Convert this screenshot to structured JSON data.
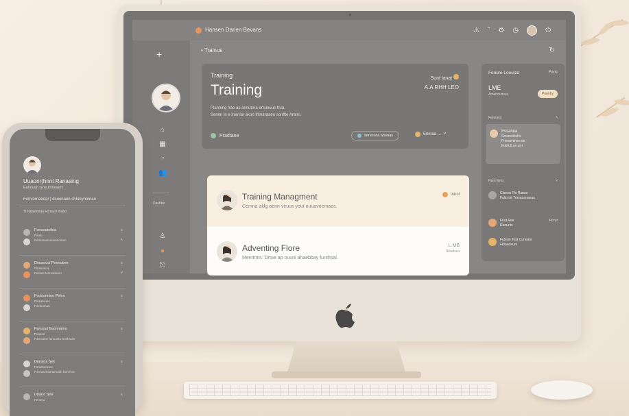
{
  "colors": {
    "accent_orange": "#e8935e",
    "accent_gold": "#e5b46a",
    "card_cream": "#f8efe1",
    "screen_gray": "#8a8886"
  },
  "desktop": {
    "topbar": {
      "title": "Hansen Darien Bevans",
      "icons": [
        "alert-icon",
        "chevron-up-icon",
        "settings-icon",
        "clock-icon",
        "avatar",
        "power-icon"
      ]
    },
    "sidebar": {
      "small_label": "Dashbo"
    },
    "breadcrumb": "Trainus",
    "hero": {
      "kicker": "Training",
      "title": "Training",
      "desc1": "Planning frae as annutora emunuus trua.",
      "desc2": "Senen in e lrorniar akon frlmaraaen sonflte Arann.",
      "top_right1": "Sunt lanat",
      "top_right2": "A.A RHH LEO",
      "footer_left": "Pradtane",
      "pill": "servouns ahanas",
      "footer_right": "Enmaa ..."
    },
    "cards": [
      {
        "title": "Training Managment",
        "subtitle": "Cemna aklg aenn veuus yout ouuavoemaas.",
        "badge": "Innol"
      },
      {
        "title": "Adventing Flore",
        "subtitle": "Menmms. Drtue ap ouuni ahaebbay funthsal.",
        "right1": "L.MB",
        "right2": "Siliudsca"
      }
    ],
    "right_panel": {
      "header": "Feriure Looujza",
      "header_right": "Foris",
      "value": "LME",
      "value_sub": "Amanoumsa",
      "button": "Ponnhy",
      "label1": "Faruiaes",
      "card_title": "Essanea",
      "card_lines": [
        "Secaredrahs",
        "Frimseninen ae",
        "Edefull ue urn"
      ],
      "label2": "Rum Eetu",
      "rows": [
        {
          "t1": "Clanon Ffo Ranoe",
          "t2": "Fulio de Trirsnunnaeas"
        },
        {
          "t1": "Fuut Ree",
          "t2": "Ranunts",
          "r": "Ru ur"
        },
        {
          "t1": "Futeuo Teat Cuneate",
          "t2": "Fhlaadauni"
        }
      ]
    }
  },
  "phone": {
    "title": "Uuaonr(hnnt Ranaaing",
    "subtitle": "Eanouan Gneumneaem",
    "line": "Fonvornaooar | dsounaen chlunynoman",
    "filter": "Tt Naasmnaa Fonsuel Inabd",
    "items": [
      {
        "t": "Fonuoutotloa",
        "a": "Peulu",
        "b": "Pentunaoloaonenomen"
      },
      {
        "t": "Deuaoucl Peenubee",
        "a": "Pinasaanu",
        "b": "Fulanie tonmanaom"
      },
      {
        "t": "Fodounniuo Peleo",
        "a": "Panoboues",
        "b": "Pacluumaa"
      },
      {
        "t": "Fanuoul Baonnaino",
        "a": "Pealunl",
        "b": "Pamoutne lanuuntu Soshaum"
      },
      {
        "t": "Dunaoa Sek",
        "a": "Famanunnen",
        "b": "Ponnaumaanamoah Somnna"
      },
      {
        "t": "Dnauo Sne",
        "a": "Fenenu"
      }
    ]
  }
}
